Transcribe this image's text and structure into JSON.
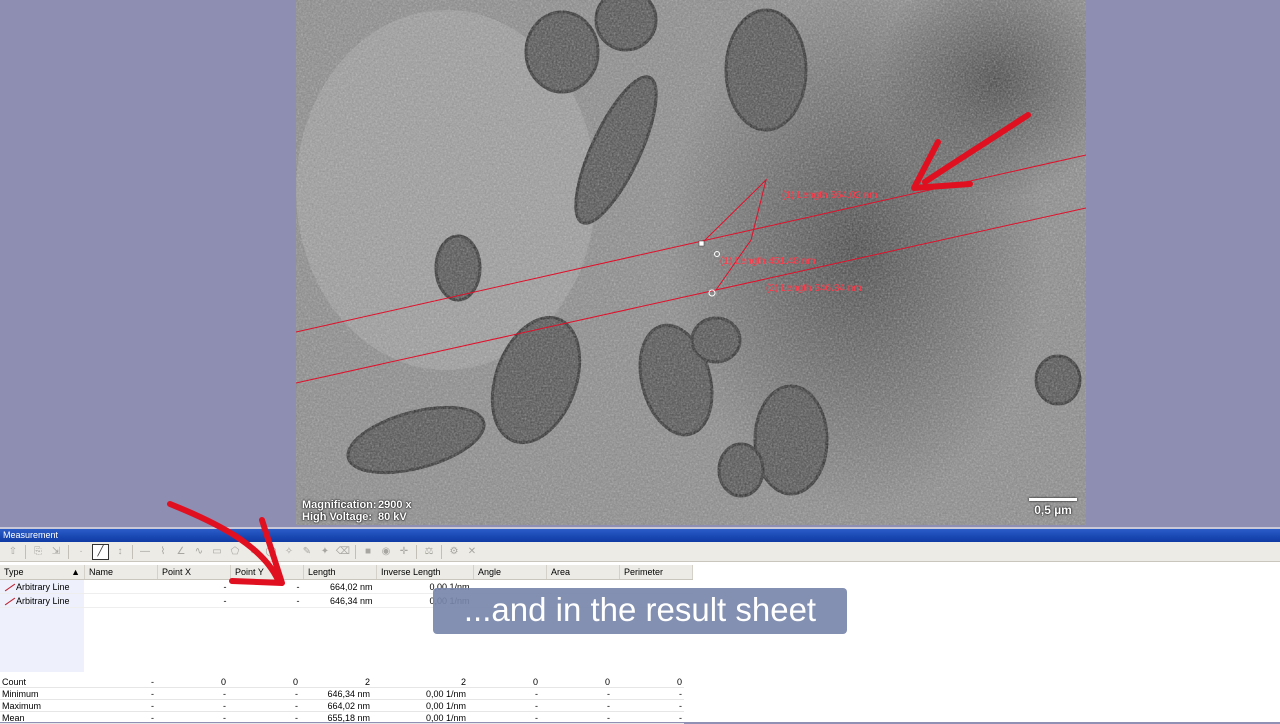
{
  "image": {
    "magnification_label": "Magnification:",
    "magnification_value": "2900 x",
    "voltage_label": "High Voltage:",
    "voltage_value": "80 kV",
    "scale_label": "0,5 µm",
    "measurements": [
      {
        "label": "(1) Length 664.02 nm"
      },
      {
        "label": "(1) Length 451.48 nm"
      },
      {
        "label": "(2) Length 646.34 nm"
      }
    ]
  },
  "panel": {
    "title": "Measurement",
    "columns": [
      "Type",
      "Name",
      "Point X",
      "Point Y",
      "Length",
      "Inverse Length",
      "Angle",
      "Area",
      "Perimeter"
    ],
    "rows": [
      {
        "type": "Arbitrary Line",
        "name": "",
        "point_x": "-",
        "point_y": "-",
        "length": "664,02 nm",
        "inverse_length": "0,00 1/nm"
      },
      {
        "type": "Arbitrary Line",
        "name": "",
        "point_x": "-",
        "point_y": "-",
        "length": "646,34 nm",
        "inverse_length": "0,00 1/nm"
      }
    ],
    "stats": [
      {
        "label": "Count",
        "vals": [
          "-",
          "0",
          "0",
          "2",
          "2",
          "0",
          "0",
          "0"
        ]
      },
      {
        "label": "Minimum",
        "vals": [
          "-",
          "-",
          "-",
          "646,34 nm",
          "0,00 1/nm",
          "-",
          "-",
          "-"
        ]
      },
      {
        "label": "Maximum",
        "vals": [
          "-",
          "-",
          "-",
          "664,02 nm",
          "0,00 1/nm",
          "-",
          "-",
          "-"
        ]
      },
      {
        "label": "Mean",
        "vals": [
          "-",
          "-",
          "-",
          "655,18 nm",
          "0,00 1/nm",
          "-",
          "-",
          "-"
        ]
      }
    ]
  },
  "caption": "...and in the result sheet",
  "colors": {
    "measure_line": "#e0102a",
    "annotation_arrow": "#e01020",
    "titlebar": "#1a47b4"
  }
}
